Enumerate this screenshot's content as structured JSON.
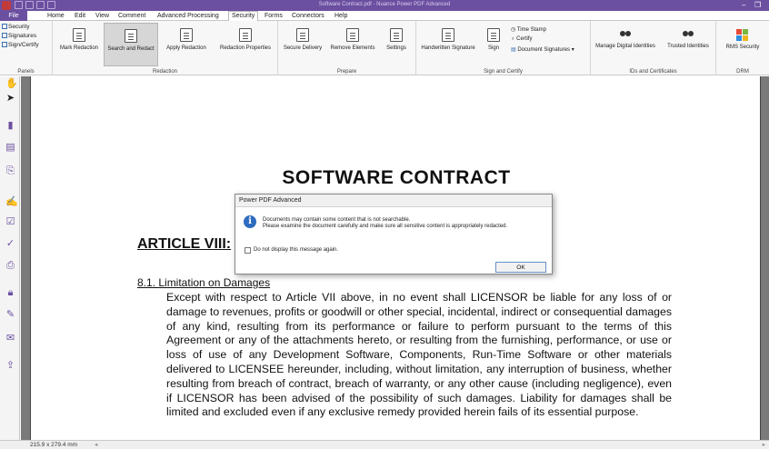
{
  "window": {
    "title": "Software Contract.pdf - Nuance Power PDF Advanced",
    "minimize": "–",
    "restore": "❐"
  },
  "menu": {
    "file": "File",
    "tabs": [
      "Home",
      "Edit",
      "View",
      "Comment",
      "Advanced Processing",
      "Security",
      "Forms",
      "Connectors",
      "Help"
    ],
    "active_tab": "Security"
  },
  "ribbon": {
    "panels": {
      "items": [
        "Security",
        "Signatures",
        "Sign/Certify"
      ],
      "label": "Panels"
    },
    "redaction": {
      "buttons": [
        "Mark Redaction",
        "Search and Redact",
        "Apply Redaction",
        "Redaction Properties"
      ],
      "label": "Redaction"
    },
    "prepare": {
      "buttons": [
        "Secure Delivery",
        "Remove Elements",
        "Settings"
      ],
      "label": "Prepare"
    },
    "sign_certify": {
      "handwritten": "Handwritten Signature",
      "sign": "Sign",
      "time_stamp": "Time Stamp",
      "certify": "Certify",
      "document_signatures": "Document Signatures",
      "label": "Sign and Certify"
    },
    "ids": {
      "buttons": [
        "Manage Digital Identities",
        "Trusted Identities"
      ],
      "label": "IDs and Certificates"
    },
    "drm": {
      "button": "RMS Security",
      "label": "DRM"
    }
  },
  "document": {
    "title": "SOFTWARE CONTRACT",
    "article": "ARTICLE VIII:",
    "section": "8.1. Limitation on Damages",
    "paragraph": "Except with respect to Article VII above, in no event shall LICENSOR be liable for any loss of or damage to revenues, profits or goodwill or other special, incidental, indirect or consequential damages of any kind, resulting from its performance or failure to perform pursuant to the terms of this Agreement or any of the attachments hereto, or resulting from the furnishing, performance, or use or loss of use of any Development Software, Components, Run-Time Software or other materials delivered to LICENSEE hereunder, including, without limitation, any interruption of business, whether resulting from breach of contract, breach of warranty, or any other cause (including negligence), even if LICENSOR has been advised of the possibility of such damages. Liability for damages shall be limited and excluded even if any exclusive remedy provided herein fails of its essential purpose."
  },
  "dialog": {
    "title": "Power PDF Advanced",
    "message_line1": "Documents may contain some content that is not searchable.",
    "message_line2": "Please examine the document carefully and make sure all sensitive content is appropriately redacted.",
    "checkbox_label": "Do not display this message again.",
    "ok": "OK"
  },
  "status": {
    "page_size": "215.9 x 279.4 mm"
  },
  "colors": {
    "accent": "#6b4fa0",
    "info_icon": "#2d6cc0"
  }
}
